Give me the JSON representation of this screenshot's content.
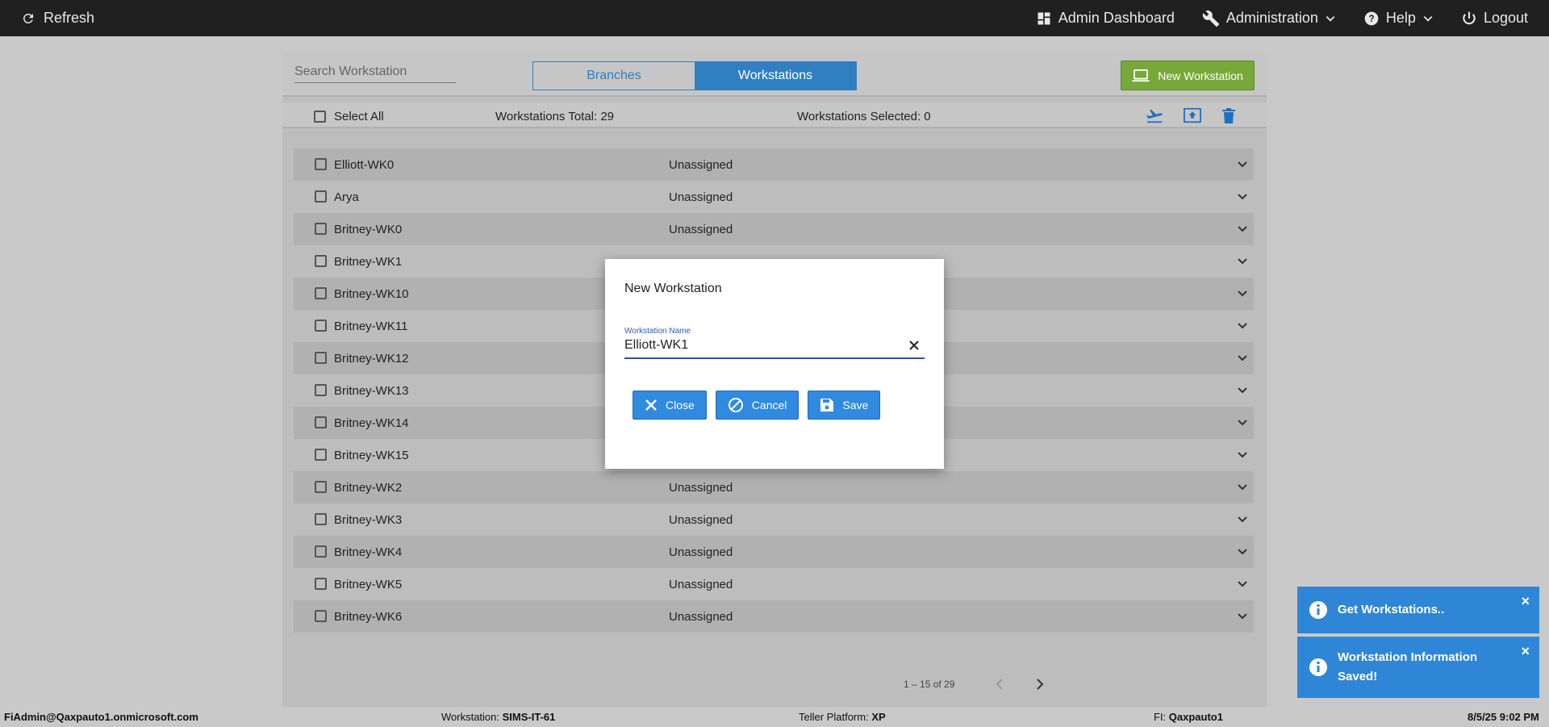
{
  "topbar": {
    "refresh_label": "Refresh",
    "admin_dashboard_label": "Admin Dashboard",
    "administration_label": "Administration",
    "help_label": "Help",
    "logout_label": "Logout"
  },
  "toolbar": {
    "search_placeholder": "Search Workstation",
    "tab_branches": "Branches",
    "tab_workstations": "Workstations",
    "active_tab": "Workstations",
    "new_workstation_label": "New Workstation"
  },
  "selection_bar": {
    "select_all_label": "Select All",
    "total_text": "Workstations Total: 29",
    "selected_text": "Workstations Selected: 0"
  },
  "rows": [
    {
      "name": "Elliott-WK0",
      "status": "Unassigned"
    },
    {
      "name": "Arya",
      "status": "Unassigned"
    },
    {
      "name": "Britney-WK0",
      "status": "Unassigned"
    },
    {
      "name": "Britney-WK1",
      "status": ""
    },
    {
      "name": "Britney-WK10",
      "status": ""
    },
    {
      "name": "Britney-WK11",
      "status": ""
    },
    {
      "name": "Britney-WK12",
      "status": ""
    },
    {
      "name": "Britney-WK13",
      "status": ""
    },
    {
      "name": "Britney-WK14",
      "status": ""
    },
    {
      "name": "Britney-WK15",
      "status": ""
    },
    {
      "name": "Britney-WK2",
      "status": "Unassigned"
    },
    {
      "name": "Britney-WK3",
      "status": "Unassigned"
    },
    {
      "name": "Britney-WK4",
      "status": "Unassigned"
    },
    {
      "name": "Britney-WK5",
      "status": "Unassigned"
    },
    {
      "name": "Britney-WK6",
      "status": "Unassigned"
    }
  ],
  "pager": {
    "range_text": "1 – 15 of 29"
  },
  "dialog": {
    "title": "New Workstation",
    "field_label": "Workstation Name",
    "field_value": "Elliott-WK1",
    "close_label": "Close",
    "cancel_label": "Cancel",
    "save_label": "Save"
  },
  "toasts": [
    {
      "text": "Get Workstations.."
    },
    {
      "text": "Workstation Information Saved!"
    }
  ],
  "statusbar": {
    "user": "FiAdmin@Qaxpauto1.onmicrosoft.com",
    "workstation_label": "Workstation:",
    "workstation_value": "SIMS-IT-61",
    "platform_label": "Teller Platform:",
    "platform_value": "XP",
    "fi_label": "FI:",
    "fi_value": "Qaxpauto1",
    "datetime": "8/5/25 9:02 PM"
  },
  "colors": {
    "accent_blue": "#2f86d6",
    "new_button_green": "#77a83a",
    "topbar_bg": "#202020"
  }
}
